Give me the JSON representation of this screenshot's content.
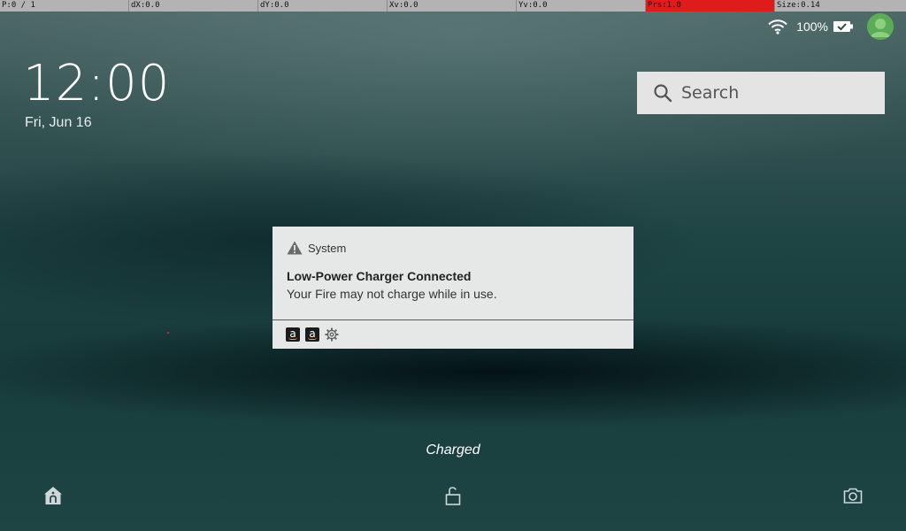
{
  "debug_bar": {
    "pointer": "P:0 / 1",
    "dx": "dX:0.0",
    "dy": "dY:0.0",
    "xv": "Xv:0.0",
    "yv": "Yv:0.0",
    "prs": "Prs:1.0",
    "size": "Size:0.14",
    "alert_color": "#e01b1b"
  },
  "status": {
    "wifi_icon": "wifi-icon",
    "battery_percent": "100%",
    "battery_icon": "battery-charged-icon",
    "avatar_icon": "user-avatar-icon",
    "avatar_color": "#5bab57"
  },
  "lockscreen": {
    "time": "12:00",
    "date": "Fri, Jun 16",
    "charging_status": "Charged"
  },
  "search": {
    "placeholder": "Search",
    "icon": "search-icon"
  },
  "notification": {
    "app_icon": "warning-icon",
    "app_name": "System",
    "title": "Low-Power Charger Connected",
    "body": "Your Fire may not charge while in use.",
    "action_icons": [
      "amazon-app-icon",
      "amazon-app-icon",
      "settings-gear-icon"
    ]
  },
  "bottom_bar": {
    "left_icon": "home-icon",
    "center_icon": "unlock-icon",
    "right_icon": "camera-icon"
  }
}
